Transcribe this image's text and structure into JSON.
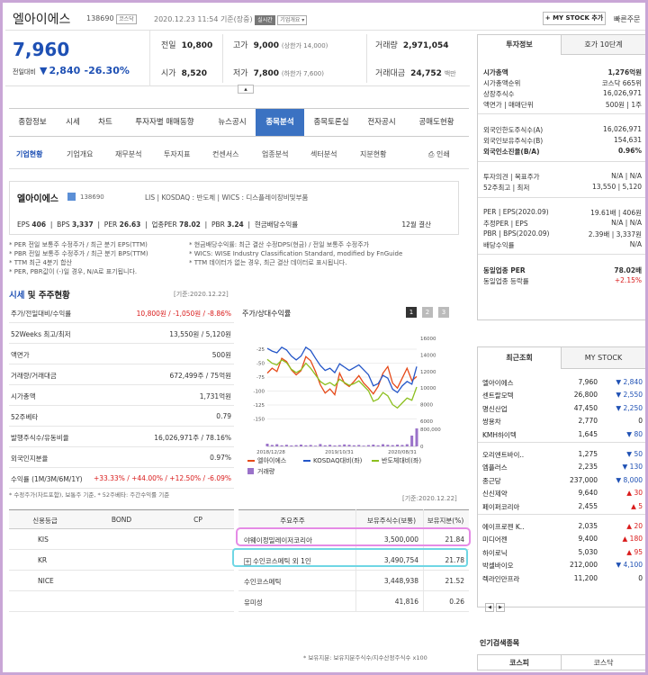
{
  "header": {
    "name": "엘아이에스",
    "code": "138690",
    "market_tag": "코스닥",
    "datetime": "2020.12.23 11:54 기준(장중)",
    "realtime_tag": "실시간",
    "company_tag": "기업개요 ▾",
    "mystock_btn": "+ MY STOCK 추가",
    "quick_order": "빠른주문"
  },
  "quote": {
    "price": "7,960",
    "change_label": "전일대비",
    "change_arrow": "▼",
    "change": "2,840",
    "rate": "-26.30%",
    "prev_close_label": "전일",
    "prev_close": "10,800",
    "high_label": "고가",
    "high": "9,000",
    "high_note": "(상한가 14,000)",
    "volume_label": "거래량",
    "volume": "2,971,054",
    "open_label": "시가",
    "open": "8,520",
    "low_label": "저가",
    "low": "7,800",
    "low_note": "(하한가 7,600)",
    "amount_label": "거래대금",
    "amount": "24,752",
    "amount_unit": "백만",
    "collapse": "▴"
  },
  "nav1": [
    "종합정보",
    "시세",
    "차트",
    "투자자별 매매동향",
    "뉴스공시",
    "종목분석",
    "종목토론실",
    "전자공시",
    "공매도현황"
  ],
  "nav2": [
    "기업현황",
    "기업개요",
    "재무분석",
    "투자지표",
    "컨센서스",
    "업종분석",
    "섹터분석",
    "지분현황"
  ],
  "print_label": "인쇄",
  "company": {
    "name": "엘아이에스",
    "code": "138690",
    "desc": "LIS  |  KOSDAQ : 반도체  |  WICS : 디스플레이장비및부품",
    "eps_label": "EPS",
    "eps": "406",
    "bps_label": "BPS",
    "bps": "3,337",
    "per_label": "PER",
    "per": "26.63",
    "iper_label": "업종PER",
    "iper": "78.02",
    "pbr_label": "PBR",
    "pbr": "3.24",
    "div_label": "현금배당수익률",
    "div": "",
    "settle": "12월 결산"
  },
  "notes": [
    "* PER 전일 보통주 수정주가 / 최근 분기 EPS(TTM)",
    "* PBR 전일 보통주 수정주가 / 최근 분기 BPS(TTM)",
    "* TTM 최근 4분기 합산",
    "* PER, PBR값이 (-)일 경우, N/A로 표기됩니다.",
    "* 현금배당수익률: 최근 결산 수정DPS(현금) / 전일 보통주 수정주가",
    "* WICS: WISE Industry Classification Standard, modified by FnGuide",
    "* TTM 데이터가 없는 경우, 최근 결산 데이터로 표시됩니다."
  ],
  "market": {
    "title1": "시세",
    "title2": " 및 주주현황",
    "date": "[기준:2020.12.22]",
    "rows": [
      {
        "l": "주가/전일대비/수익률",
        "v": "10,800원 / -1,050원 / -8.86%"
      },
      {
        "l": "52Weeks 최고/최저",
        "v": "13,550원 / 5,120원"
      },
      {
        "l": "액면가",
        "v": "500원"
      },
      {
        "l": "거래량/거래대금",
        "v": "672,499주 / 75억원"
      },
      {
        "l": "시가총액",
        "v": "1,731억원"
      },
      {
        "l": "52주베타",
        "v": "0.79"
      },
      {
        "l": "발행주식수/유동비율",
        "v": "16,026,971주 / 78.16%"
      },
      {
        "l": "외국인지분율",
        "v": "0.97%"
      },
      {
        "l": "수익률 (1M/3M/6M/1Y)",
        "v": "+33.33% / +44.00% / +12.50% / -6.09%"
      }
    ],
    "note": "* 수정주가(차트포함), 보통주 기준, * 52주베타: 주간수익률 기준"
  },
  "chart": {
    "title": "주가/상대수익률",
    "pages": [
      "1",
      "2",
      "3"
    ]
  },
  "chart_data": {
    "type": "line",
    "x": [
      "2018/12/28",
      "2019/10/31",
      "2020/08/31"
    ],
    "series": [
      {
        "name": "엘아이에스",
        "axis": "right",
        "color": "#e64a19",
        "values": [
          11800,
          12400,
          12000,
          13600,
          13200,
          12200,
          11600,
          12100,
          13800,
          13300,
          12000,
          10400,
          9400,
          9900,
          9200,
          11800,
          10600,
          10200,
          10800,
          11500,
          10600,
          10000,
          9300,
          10200,
          11800,
          12600,
          10600,
          10000,
          11200,
          12400,
          10900,
          11400
        ]
      },
      {
        "name": "KOSDAQ대비(좌)",
        "axis": "left",
        "color": "#2456c8",
        "values": [
          -18,
          -23,
          -26,
          -16,
          -21,
          -32,
          -39,
          -32,
          -16,
          -22,
          -36,
          -49,
          -58,
          -54,
          -62,
          -46,
          -52,
          -58,
          -53,
          -48,
          -57,
          -66,
          -86,
          -82,
          -67,
          -72,
          -92,
          -98,
          -86,
          -78,
          -83,
          -51
        ]
      },
      {
        "name": "반도체대비(좌)",
        "axis": "left",
        "color": "#8cbf1e",
        "values": [
          -38,
          -45,
          -48,
          -39,
          -44,
          -56,
          -62,
          -57,
          -45,
          -54,
          -66,
          -78,
          -84,
          -80,
          -86,
          -74,
          -80,
          -85,
          -82,
          -77,
          -86,
          -95,
          -114,
          -110,
          -98,
          -104,
          -120,
          -126,
          -117,
          -108,
          -112,
          -88
        ]
      },
      {
        "name": "거래량",
        "axis": "volume",
        "color": "#9a72c9",
        "values": [
          150000,
          80000,
          120000,
          60000,
          90000,
          50000,
          70000,
          100000,
          60000,
          80000,
          40000,
          130000,
          60000,
          90000,
          50000,
          70000,
          110000,
          90000,
          60000,
          80000,
          40000,
          70000,
          100000,
          60000,
          120000,
          90000,
          70000,
          100000,
          80000,
          120000,
          600000,
          1000000
        ]
      }
    ],
    "left_ticks": [
      "-25",
      "-50",
      "-75",
      "-100",
      "-125",
      "-150"
    ],
    "right_ticks": [
      "16000",
      "14000",
      "12000",
      "10000",
      "8000",
      "6000"
    ],
    "vol_ticks": [
      "800,000",
      "0"
    ]
  },
  "credit": {
    "headers": [
      "신용등급",
      "BOND",
      "CP"
    ],
    "rows": [
      "KIS",
      "KR",
      "NICE"
    ]
  },
  "share": {
    "date": "[기준:2020.12.22]",
    "headers": [
      "주요주주",
      "보유주식수(보통)",
      "보유지분(%)"
    ],
    "rows": [
      {
        "n": "야웨이정밀레이저코리아",
        "q": "3,500,000",
        "r": "21.84"
      },
      {
        "n": "수인코스메틱 외 1인",
        "q": "3,490,754",
        "r": "21.78",
        "expand": "+"
      },
      {
        "n": "수인코스메틱",
        "q": "3,448,938",
        "r": "21.52"
      },
      {
        "n": "유미성",
        "q": "41,816",
        "r": "0.26"
      }
    ],
    "note": "* 보유지분: 보유지분주식수/지수산정주식수 x100"
  },
  "invest": {
    "tabs": [
      "투자정보",
      "호가 10단계"
    ],
    "rows": [
      {
        "l": "시가총액",
        "v": "1,276억원"
      },
      {
        "l": "시가총액순위",
        "v": "코스닥 665위"
      },
      {
        "l": "상장주식수",
        "v": "16,026,971"
      },
      {
        "l": "액면가 | 매매단위",
        "v": "500원 | 1주"
      },
      {
        "l": "외국인한도주식수(A)",
        "v": "16,026,971"
      },
      {
        "l": "외국인보유주식수(B)",
        "v": "154,631"
      },
      {
        "l": "외국인소진율(B/A)",
        "v": "0.96%"
      },
      {
        "l": "투자의견 | 목표주가",
        "v": "N/A | N/A"
      },
      {
        "l": "52주최고 | 최저",
        "v": "13,550 | 5,120"
      },
      {
        "l": "PER | EPS(2020.09)",
        "v": "19.61배 | 406원"
      },
      {
        "l": "추정PER | EPS",
        "v": "N/A | N/A"
      },
      {
        "l": "PBR | BPS(2020.09)",
        "v": "2.39배 | 3,337원"
      },
      {
        "l": "배당수익률",
        "v": "N/A"
      },
      {
        "l": "동일업종 PER",
        "v": "78.02배"
      },
      {
        "l": "동일업종 등락률",
        "v": "+2.15%"
      }
    ]
  },
  "recent": {
    "tabs": [
      "최근조회",
      "MY STOCK"
    ],
    "rows": [
      {
        "n": "엘아이에스",
        "p": "7,960",
        "d": "dn",
        "c": "2,840"
      },
      {
        "n": "센트랄모텍",
        "p": "26,800",
        "d": "dn",
        "c": "2,550"
      },
      {
        "n": "명신산업",
        "p": "47,450",
        "d": "dn",
        "c": "2,250"
      },
      {
        "n": "쌍용차",
        "p": "2,770",
        "d": "",
        "c": "0"
      },
      {
        "n": "KMH하이텍",
        "p": "1,645",
        "d": "dn",
        "c": "80"
      },
      {
        "n": "오리엔트바이..",
        "p": "1,275",
        "d": "dn",
        "c": "50"
      },
      {
        "n": "엠플러스",
        "p": "2,235",
        "d": "dn",
        "c": "130"
      },
      {
        "n": "종근당",
        "p": "237,000",
        "d": "dn",
        "c": "8,000"
      },
      {
        "n": "신신제약",
        "p": "9,640",
        "d": "up",
        "c": "30"
      },
      {
        "n": "페이퍼코리아",
        "p": "2,455",
        "d": "up",
        "c": "5"
      },
      {
        "n": "에이프로젠 K..",
        "p": "2,035",
        "d": "up",
        "c": "20"
      },
      {
        "n": "미디어젠",
        "p": "9,400",
        "d": "up",
        "c": "180"
      },
      {
        "n": "하이로닉",
        "p": "5,030",
        "d": "up",
        "c": "95"
      },
      {
        "n": "박셀바이오",
        "p": "212,000",
        "d": "dn",
        "c": "4,100"
      },
      {
        "n": "렉라인만프라",
        "p": "11,200",
        "d": "",
        "c": "0"
      }
    ],
    "pager": [
      "◀",
      "▶"
    ]
  },
  "popular": {
    "title": "인기검색종목",
    "tabs": [
      "코스피",
      "코스닥"
    ]
  },
  "colors": {
    "accent": "#1e50b4",
    "up": "#d91a1a",
    "down": "#1e50b4",
    "nav_active": "#3b72c2",
    "highlight1": "#e58be6",
    "highlight2": "#6fd6e4"
  }
}
